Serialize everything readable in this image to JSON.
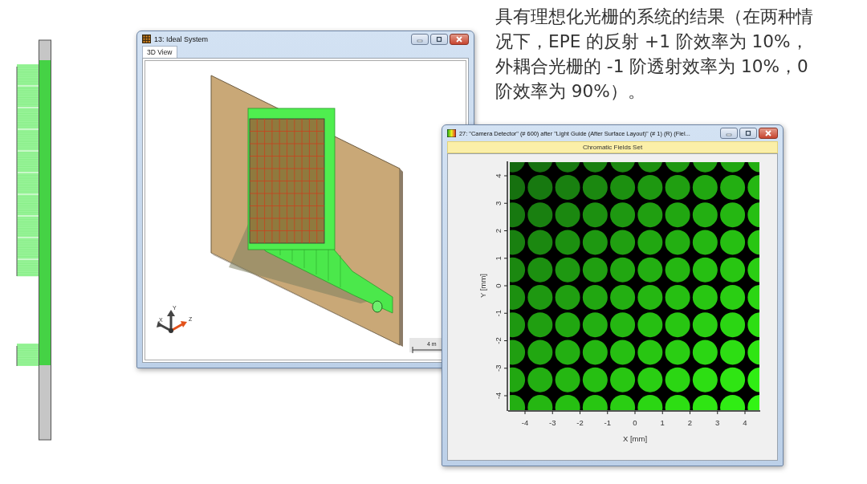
{
  "caption": {
    "lines": [
      "具有理想化光栅的系统的结果（在两种情",
      "况下，EPE 的反射 +1 阶效率为 10%，",
      "外耦合光栅的 -1 阶透射效率为 10%，0",
      "阶效率为 90%）。"
    ]
  },
  "windows": [
    {
      "title": "13: Ideal System",
      "tabs": [
        {
          "label": "3D View",
          "selected": true
        }
      ],
      "view_3d": {
        "axis_labels": [
          "X",
          "Y",
          "Z"
        ],
        "scale_label": "4 m"
      }
    },
    {
      "title": "27: \"Camera Detector\" (# 600) after \"Light Guide (After Surface Layout)\" (# 1) (R) (Fiel...",
      "banner": "Chromatic Fields Set",
      "plot": {
        "x_ticks": [
          "-4",
          "-3",
          "-2",
          "-1",
          "0",
          "1",
          "2",
          "3",
          "4"
        ],
        "y_ticks": [
          "-4",
          "-3",
          "-2",
          "-1",
          "0",
          "1",
          "2",
          "3",
          "4"
        ],
        "x_label": "X [mm]",
        "y_label": "Y [mm]"
      }
    }
  ]
}
